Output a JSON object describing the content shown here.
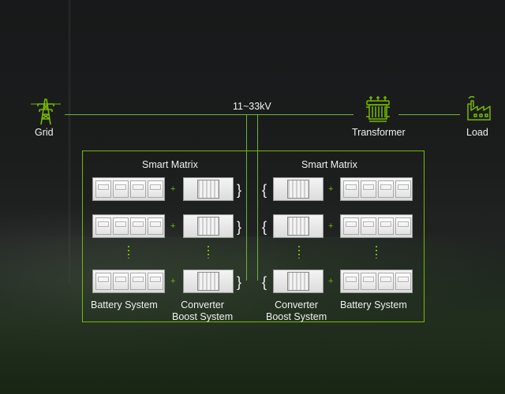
{
  "top": {
    "voltage_label": "11~33kV",
    "grid_label": "Grid",
    "transformer_label": "Transformer",
    "load_label": "Load"
  },
  "left_matrix": {
    "title": "Smart Matrix",
    "battery_label": "Battery System",
    "converter_label_line1": "Converter",
    "converter_label_line2": "Boost System"
  },
  "right_matrix": {
    "title": "Smart Matrix",
    "battery_label": "Battery System",
    "converter_label_line1": "Converter",
    "converter_label_line2": "Boost System"
  },
  "colors": {
    "accent": "#76b900",
    "line": "#6cb33f",
    "text": "#f0f0f0"
  },
  "icons": [
    "power-tower-icon",
    "transformer-icon",
    "factory-icon"
  ]
}
